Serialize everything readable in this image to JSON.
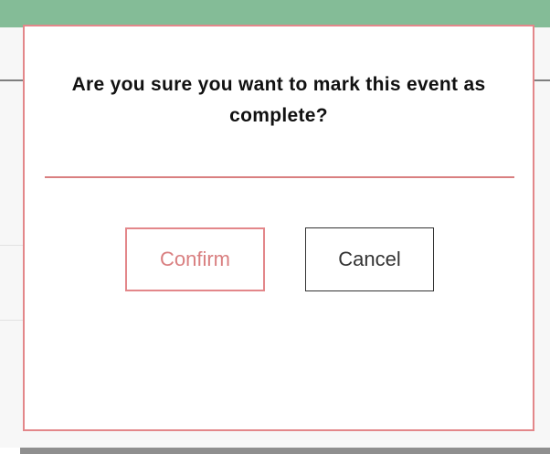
{
  "dialog": {
    "message": "Are you sure you want to mark this event as complete?",
    "confirm_label": "Confirm",
    "cancel_label": "Cancel"
  },
  "colors": {
    "header_green": "#84bc97",
    "dialog_border": "#e3878a",
    "confirm_text": "#d97f80",
    "cancel_border": "#333333"
  }
}
